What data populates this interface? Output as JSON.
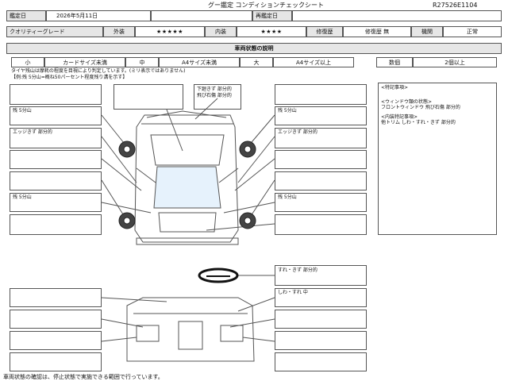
{
  "header": {
    "title": "グー鑑定 コンディションチェックシート",
    "sheet_no": "R27526E1104",
    "appraisal_date_label": "鑑定日",
    "appraisal_date": "2026年5月11日",
    "reappraisal_label": "再鑑定日",
    "reappraisal_date": ""
  },
  "grades": {
    "quality_label": "クオリティーグレード",
    "quality_value": "",
    "exterior_label": "外装",
    "exterior_stars": "★★★★★",
    "interior_label": "内装",
    "interior_stars": "★★★★",
    "repair_label": "修復歴",
    "repair_value": "修復歴 無",
    "equipment_label": "機関",
    "equipment_value": "正常"
  },
  "legend": {
    "section_title": "車両状態の説明",
    "small": "小",
    "small_desc": "カードサイズ未満",
    "medium": "中",
    "medium_desc": "A4サイズ未満",
    "large": "大",
    "large_desc": "A4サイズ以上",
    "count_label": "数個",
    "count_desc": "2個以上"
  },
  "tire_note": {
    "line1": "タイヤ残山は摩耗の程度を目視により判定しています。(ミリ表示ではありません)",
    "line2": "【例:残 5分山=概ね50パーセント程度残り溝を示す】"
  },
  "diagram_labels": {
    "top_center": "下廻きず 部分的",
    "top_center2": "飛び石傷 部分的",
    "left_tire_front": "残 5分山",
    "left_edge": "エッジきず 部分的",
    "right_tire_front": "残 5分山",
    "right_edge": "エッジきず 部分的",
    "left_tire_rear": "残 5分山",
    "right_tire_rear": "残 5分山",
    "steering": "すれ・きず 部分的",
    "seat": "しわ・すれ 中"
  },
  "special": {
    "title": "<特記事項>",
    "window_title": "<ウィンドウ類の状態>",
    "window_desc": "フロントウィンドウ 飛び石傷 部分的",
    "interior_title": "<内装特記事項>",
    "interior_desc": "他トリム しわ・すれ・きず 部分的"
  },
  "footer": "車両状態の確認は、停止状態で実施できる範囲で行っています。"
}
